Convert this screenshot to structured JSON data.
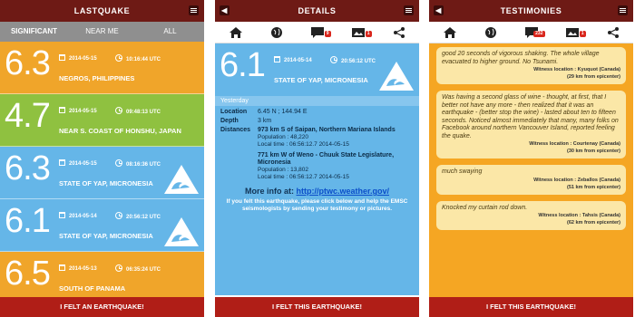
{
  "list_screen": {
    "title": "LASTQUAKE",
    "filters": [
      "SIGNIFICANT",
      "NEAR ME",
      "ALL"
    ],
    "quakes": [
      {
        "mag": "6.3",
        "date": "2014-05-15",
        "time": "10:16:44 UTC",
        "place": "NEGROS, PHILIPPINES",
        "color": "#f0a52a",
        "tsunami": false
      },
      {
        "mag": "4.7",
        "date": "2014-05-15",
        "time": "09:48:13 UTC",
        "place": "NEAR S. COAST OF HONSHU, JAPAN",
        "color": "#8fc140",
        "tsunami": false
      },
      {
        "mag": "6.3",
        "date": "2014-05-15",
        "time": "08:16:36 UTC",
        "place": "STATE OF YAP, MICRONESIA",
        "color": "#65b6e8",
        "tsunami": true
      },
      {
        "mag": "6.1",
        "date": "2014-05-14",
        "time": "20:56:12 UTC",
        "place": "STATE OF YAP, MICRONESIA",
        "color": "#65b6e8",
        "tsunami": true
      },
      {
        "mag": "6.5",
        "date": "2014-05-13",
        "time": "06:35:24 UTC",
        "place": "SOUTH OF PANAMA",
        "color": "#f0a52a",
        "tsunami": false
      }
    ],
    "button": "I FELT AN EARTHQUAKE!"
  },
  "details_screen": {
    "title": "DETAILS",
    "badges": {
      "comments": "9",
      "pictures": "1"
    },
    "mag": "6.1",
    "date": "2014-05-14",
    "time": "20:56:12 UTC",
    "place": "STATE OF YAP, MICRONESIA",
    "when": "Yesterday",
    "location_label": "Location",
    "location": "6.45 N ; 144.94 E",
    "depth_label": "Depth",
    "depth": "3 km",
    "distances_label": "Distances",
    "distances": [
      {
        "name": "973 km S of Saipan, Northern Mariana Islands",
        "population": "Population : 48,220",
        "local_time": "Local time : 06:56:12.7 2014-05-15"
      },
      {
        "name": "771 km W of Weno - Chuuk State Legislature, Micronesia",
        "population": "Population : 13,802",
        "local_time": "Local time : 06:56:12.7 2014-05-15"
      }
    ],
    "more_info_label": "More info at:",
    "more_info_link": "http://ptwc.weather.gov/",
    "felt_note": "If you felt this earthquake, please click below and help the EMSC seismologists by sending your testimony or pictures.",
    "button": "I FELT THIS EARTHQUAKE!"
  },
  "testimonies_screen": {
    "title": "TESTIMONIES",
    "badges": {
      "comments": "232",
      "pictures": "1"
    },
    "items": [
      {
        "text": "good 20 seconds of vigorous shaking. The whole village evacuated to higher ground. No Tsunami.",
        "loc": "Witness location : Kyuquot (Canada)",
        "dist": "(29 km from epicenter)"
      },
      {
        "text": "Was having a second glass of wine - thought, at first, that I better not have any more - then realized that it was an earthquake - (better stop the wine) - lasted about ten to fifteen seconds. Noticed almost immediately that many, many folks on Facebook around northern Vancouver Island, reported feeling the quake.",
        "loc": "Witness location : Courtenay (Canada)",
        "dist": "(30 km from epicenter)"
      },
      {
        "text": "much swaying",
        "loc": "Witness location : Zeballos (Canada)",
        "dist": "(51 km from epicenter)"
      },
      {
        "text": "Knocked my curtain rod down.",
        "loc": "Witness location : Tahsis (Canada)",
        "dist": "(62 km from epicenter)"
      }
    ],
    "button": "I FELT THIS EARTHQUAKE!"
  },
  "colors": {
    "topbar": "#6e1a15",
    "button": "#b01e17",
    "orange": "#f0a52a",
    "green": "#8fc140",
    "blue": "#65b6e8"
  }
}
